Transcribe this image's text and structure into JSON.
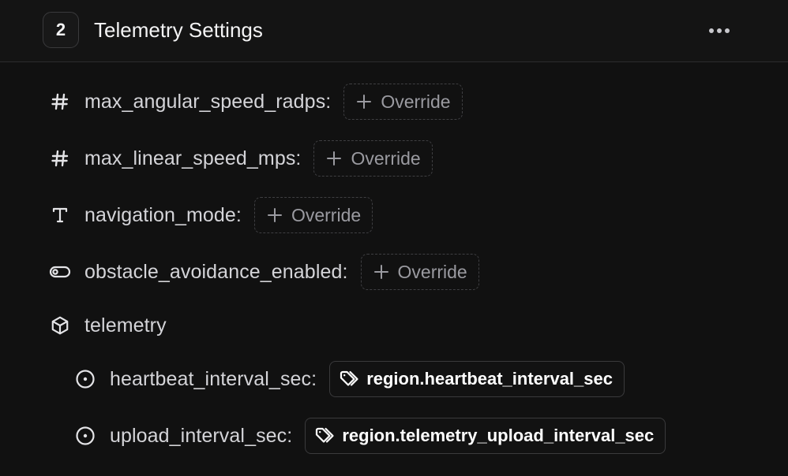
{
  "header": {
    "step_number": "2",
    "title": "Telemetry Settings",
    "more_icon": "more-horizontal-icon"
  },
  "override_label": "Override",
  "fields": [
    {
      "name": "max_angular_speed_radps:",
      "icon": "hash-icon"
    },
    {
      "name": "max_linear_speed_mps:",
      "icon": "hash-icon"
    },
    {
      "name": "navigation_mode:",
      "icon": "text-type-icon"
    },
    {
      "name": "obstacle_avoidance_enabled:",
      "icon": "toggle-icon"
    }
  ],
  "group": {
    "name": "telemetry",
    "icon": "cube-icon",
    "children": [
      {
        "name": "heartbeat_interval_sec:",
        "icon": "circle-dot-icon",
        "reference": "region.heartbeat_interval_sec"
      },
      {
        "name": "upload_interval_sec:",
        "icon": "circle-dot-icon",
        "reference": "region.telemetry_upload_interval_sec"
      }
    ]
  },
  "colors": {
    "background": "#111111",
    "header_background": "#141414",
    "text": "#d4d4d8",
    "muted": "#9a9aa0",
    "border": "#3a3a3c"
  }
}
